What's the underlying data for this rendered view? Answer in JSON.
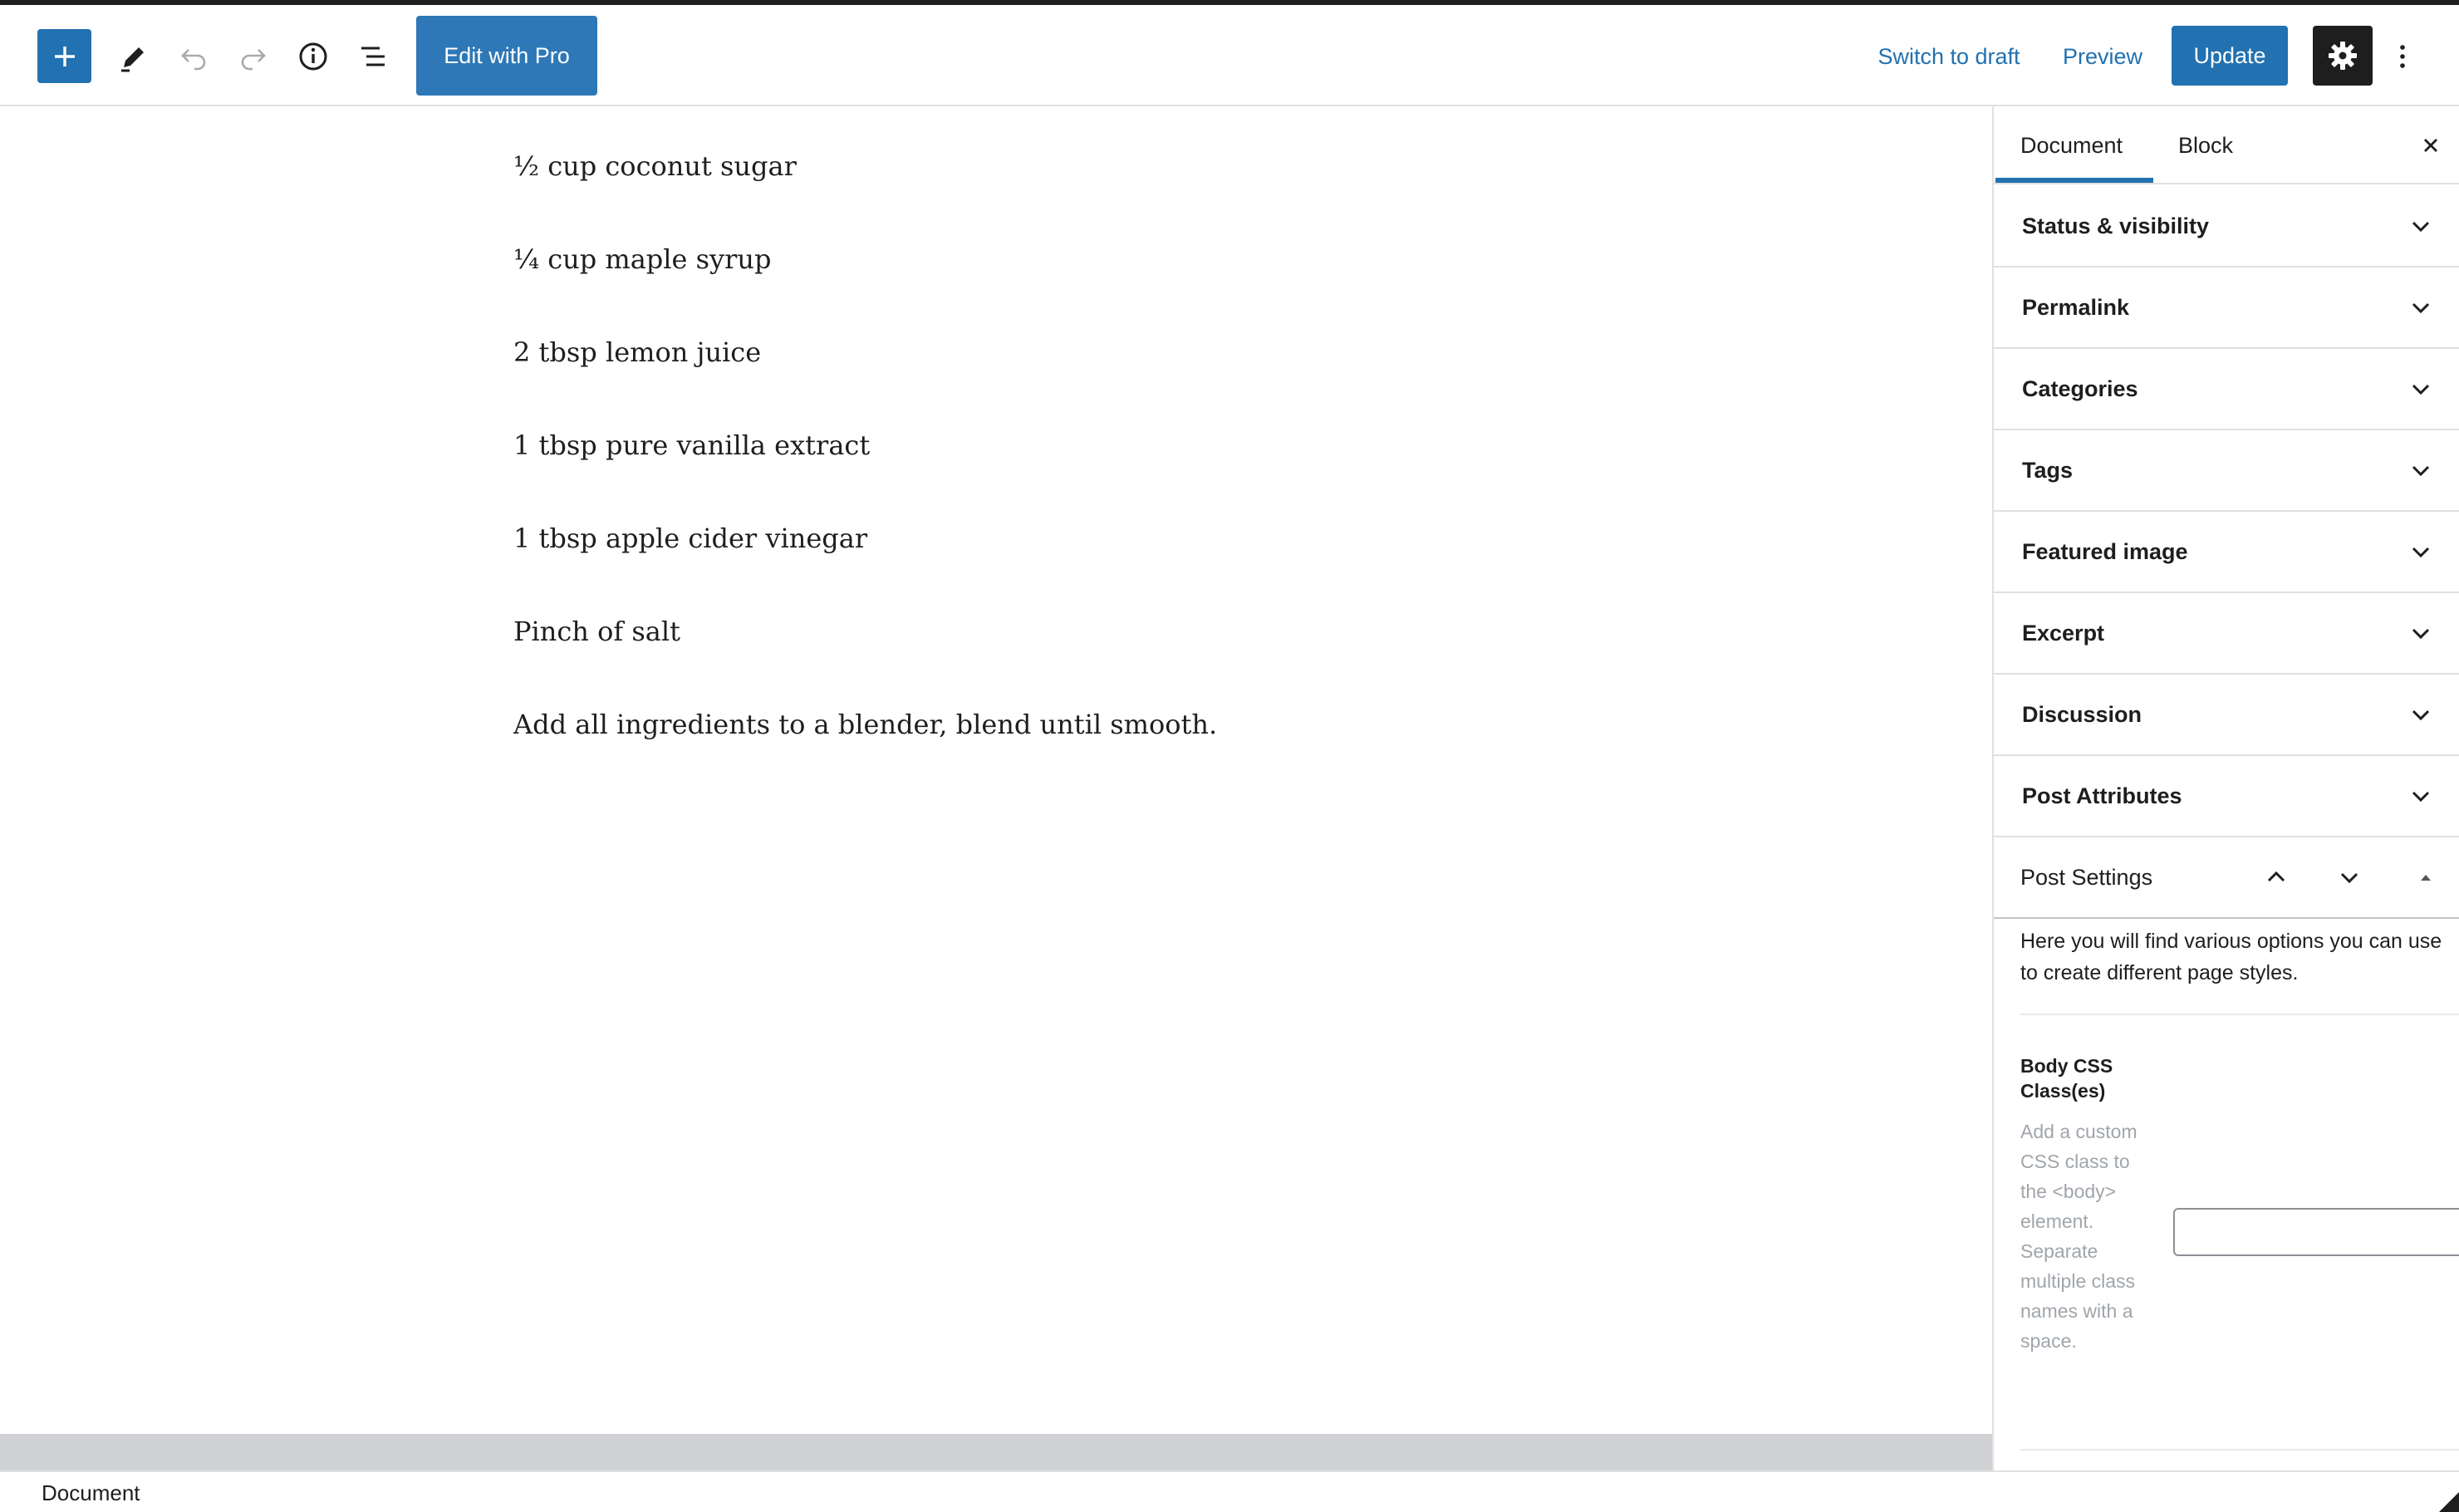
{
  "toolbar": {
    "add_block_icon": "plus-icon",
    "tools_icon": "pencil-icon",
    "undo_icon": "undo-icon",
    "redo_icon": "redo-icon",
    "info_icon": "info-icon",
    "outline_icon": "list-view-icon",
    "edit_pro_label": "Edit with Pro",
    "switch_draft_label": "Switch to draft",
    "preview_label": "Preview",
    "update_label": "Update",
    "settings_icon": "gear-icon",
    "more_icon": "more-vertical-icon"
  },
  "content": {
    "paragraphs": [
      "½ cup coconut sugar",
      "¼ cup maple syrup",
      "2 tbsp lemon juice",
      "1 tbsp pure vanilla extract",
      "1 tbsp apple cider vinegar",
      "Pinch of salt",
      "Add all ingredients to a blender, blend until smooth."
    ]
  },
  "sidebar": {
    "tabs": [
      {
        "label": "Document",
        "active": true
      },
      {
        "label": "Block",
        "active": false
      }
    ],
    "close_icon": "close-icon",
    "panels": [
      "Status & visibility",
      "Permalink",
      "Categories",
      "Tags",
      "Featured image",
      "Excerpt",
      "Discussion",
      "Post Attributes"
    ],
    "post_settings": {
      "title": "Post Settings",
      "description": "Here you will find various options you can use to create different page styles.",
      "body_css_label": "Body CSS Class(es)",
      "body_css_help": "Add a custom CSS class to the <body> element. Separate multiple class names with a space.",
      "body_css_value": ""
    }
  },
  "footer": {
    "breadcrumb": "Document"
  },
  "colors": {
    "accent": "#2271b1",
    "dark": "#1e1e1e",
    "border": "#e0e0e0"
  }
}
